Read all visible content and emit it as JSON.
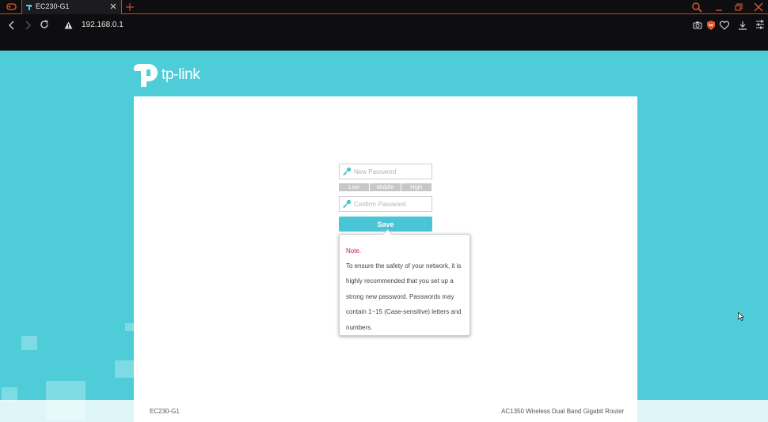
{
  "browser": {
    "tab_title": "EC230-G1",
    "url": "192.168.0.1",
    "accent_color": "#c6471d"
  },
  "logo": {
    "text": "tp-link"
  },
  "form": {
    "new_password_placeholder": "New Password",
    "confirm_password_placeholder": "Confirm Password",
    "strength": {
      "low": "Low",
      "middle": "Middle",
      "high": "High"
    },
    "save_label": "Save"
  },
  "note": {
    "title": "Note.",
    "body": "To ensure the safety of your network, it is highly recommended that you set up a strong new password. Passwords may contain 1~15 (Case-sensitive) letters and numbers."
  },
  "footer": {
    "model": "EC230-G1",
    "description": "AC1350 Wireless Dual Band Gigabit Router"
  },
  "colors": {
    "background": "#4ecdd8",
    "button": "#4ac5d6",
    "note_title": "#c2185b"
  }
}
